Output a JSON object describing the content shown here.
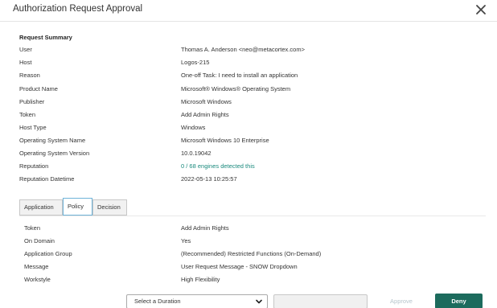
{
  "dialog": {
    "title": "Authorization Request Approval",
    "close_icon": "close-icon"
  },
  "summary": {
    "heading": "Request Summary",
    "rows": [
      {
        "label": "User",
        "value": "Thomas A. Anderson <neo@metacortex.com>"
      },
      {
        "label": "Host",
        "value": "Logos-215"
      },
      {
        "label": "Reason",
        "value": "One-off Task: I need to install an application"
      },
      {
        "label": "Product Name",
        "value": "Microsoft® Windows® Operating System"
      },
      {
        "label": "Publisher",
        "value": "Microsoft Windows"
      },
      {
        "label": "Token",
        "value": "Add Admin Rights"
      },
      {
        "label": "Host Type",
        "value": "Windows"
      },
      {
        "label": "Operating System Name",
        "value": "Microsoft Windows 10 Enterprise"
      },
      {
        "label": "Operating System Version",
        "value": "10.0.19042"
      },
      {
        "label": "Reputation",
        "value": "0 / 68 engines detected this"
      },
      {
        "label": "Reputation Datetime",
        "value": "2022-05-13 10:25:57"
      }
    ]
  },
  "tabs": [
    {
      "label": "Application",
      "active": false
    },
    {
      "label": "Policy",
      "active": true
    },
    {
      "label": "Decision",
      "active": false
    }
  ],
  "policy": {
    "rows": [
      {
        "label": "Token",
        "value": "Add Admin Rights"
      },
      {
        "label": "On Domain",
        "value": "Yes"
      },
      {
        "label": "Application Group",
        "value": "(Recommended) Restricted Functions (On-Demand)"
      },
      {
        "label": "Message",
        "value": "User Request Message - SNOW Dropdown"
      },
      {
        "label": "Workstyle",
        "value": "High Flexibility"
      }
    ]
  },
  "footer": {
    "duration_select": "Select a Duration",
    "approve_label": "Approve",
    "deny_label": "Deny"
  },
  "colors": {
    "link": "#1a8a7d",
    "deny_bg": "#1c6b5d",
    "active_tab_border": "#6fb3d8"
  }
}
